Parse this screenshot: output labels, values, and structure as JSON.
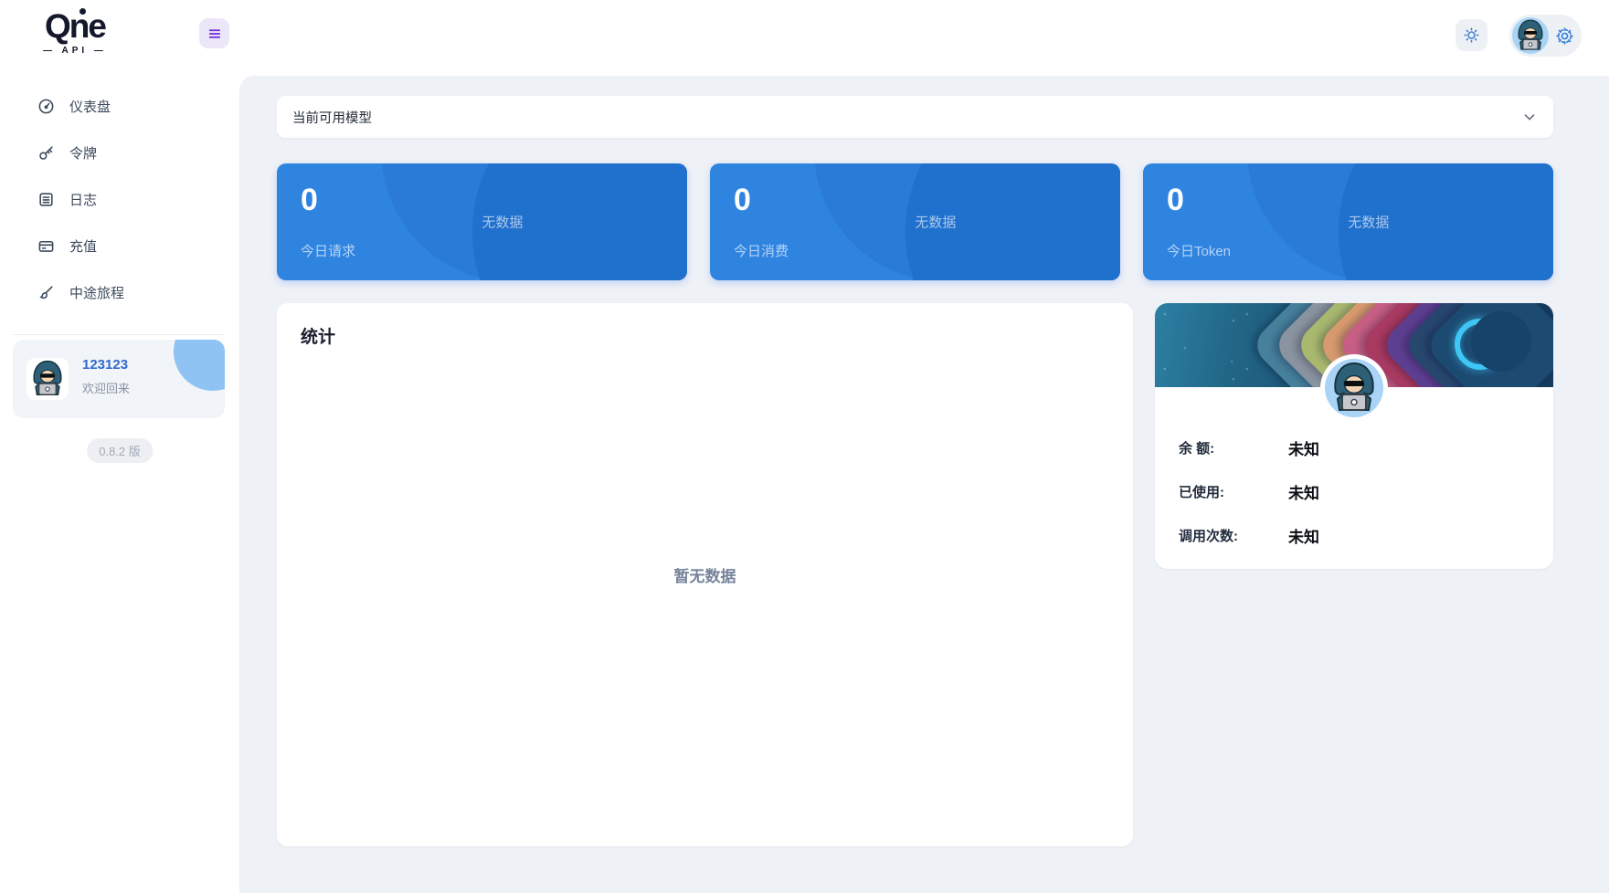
{
  "brand": {
    "name": "Qne",
    "sub": "—  API  —"
  },
  "sidebar": {
    "items": [
      {
        "label": "仪表盘",
        "icon": "gauge-icon"
      },
      {
        "label": "令牌",
        "icon": "key-icon"
      },
      {
        "label": "日志",
        "icon": "logs-icon"
      },
      {
        "label": "充值",
        "icon": "credit-card-icon"
      },
      {
        "label": "中途旅程",
        "icon": "paintbrush-icon"
      }
    ],
    "user": {
      "name": "123123",
      "greeting": "欢迎回来"
    },
    "version": "0.8.2 版"
  },
  "model_bar": {
    "label": "当前可用模型"
  },
  "stat_cards": [
    {
      "value": "0",
      "label": "今日请求",
      "empty": "无数据"
    },
    {
      "value": "0",
      "label": "今日消费",
      "empty": "无数据"
    },
    {
      "value": "0",
      "label": "今日Token",
      "empty": "无数据"
    }
  ],
  "stats_panel": {
    "title": "统计",
    "empty": "暂无数据"
  },
  "profile_card": {
    "rows": [
      {
        "label": "余 额:",
        "value": "未知"
      },
      {
        "label": "已使用:",
        "value": "未知"
      },
      {
        "label": "调用次数:",
        "value": "未知"
      }
    ]
  },
  "colors": {
    "accent_blue": "#3b82d6",
    "stat_card_blue": "#2f84e0",
    "main_bg": "#eef1f6",
    "hamburger_purple": "#6d28d9",
    "username_blue": "#3069cf",
    "moon_cyan": "#3ec6f5"
  }
}
